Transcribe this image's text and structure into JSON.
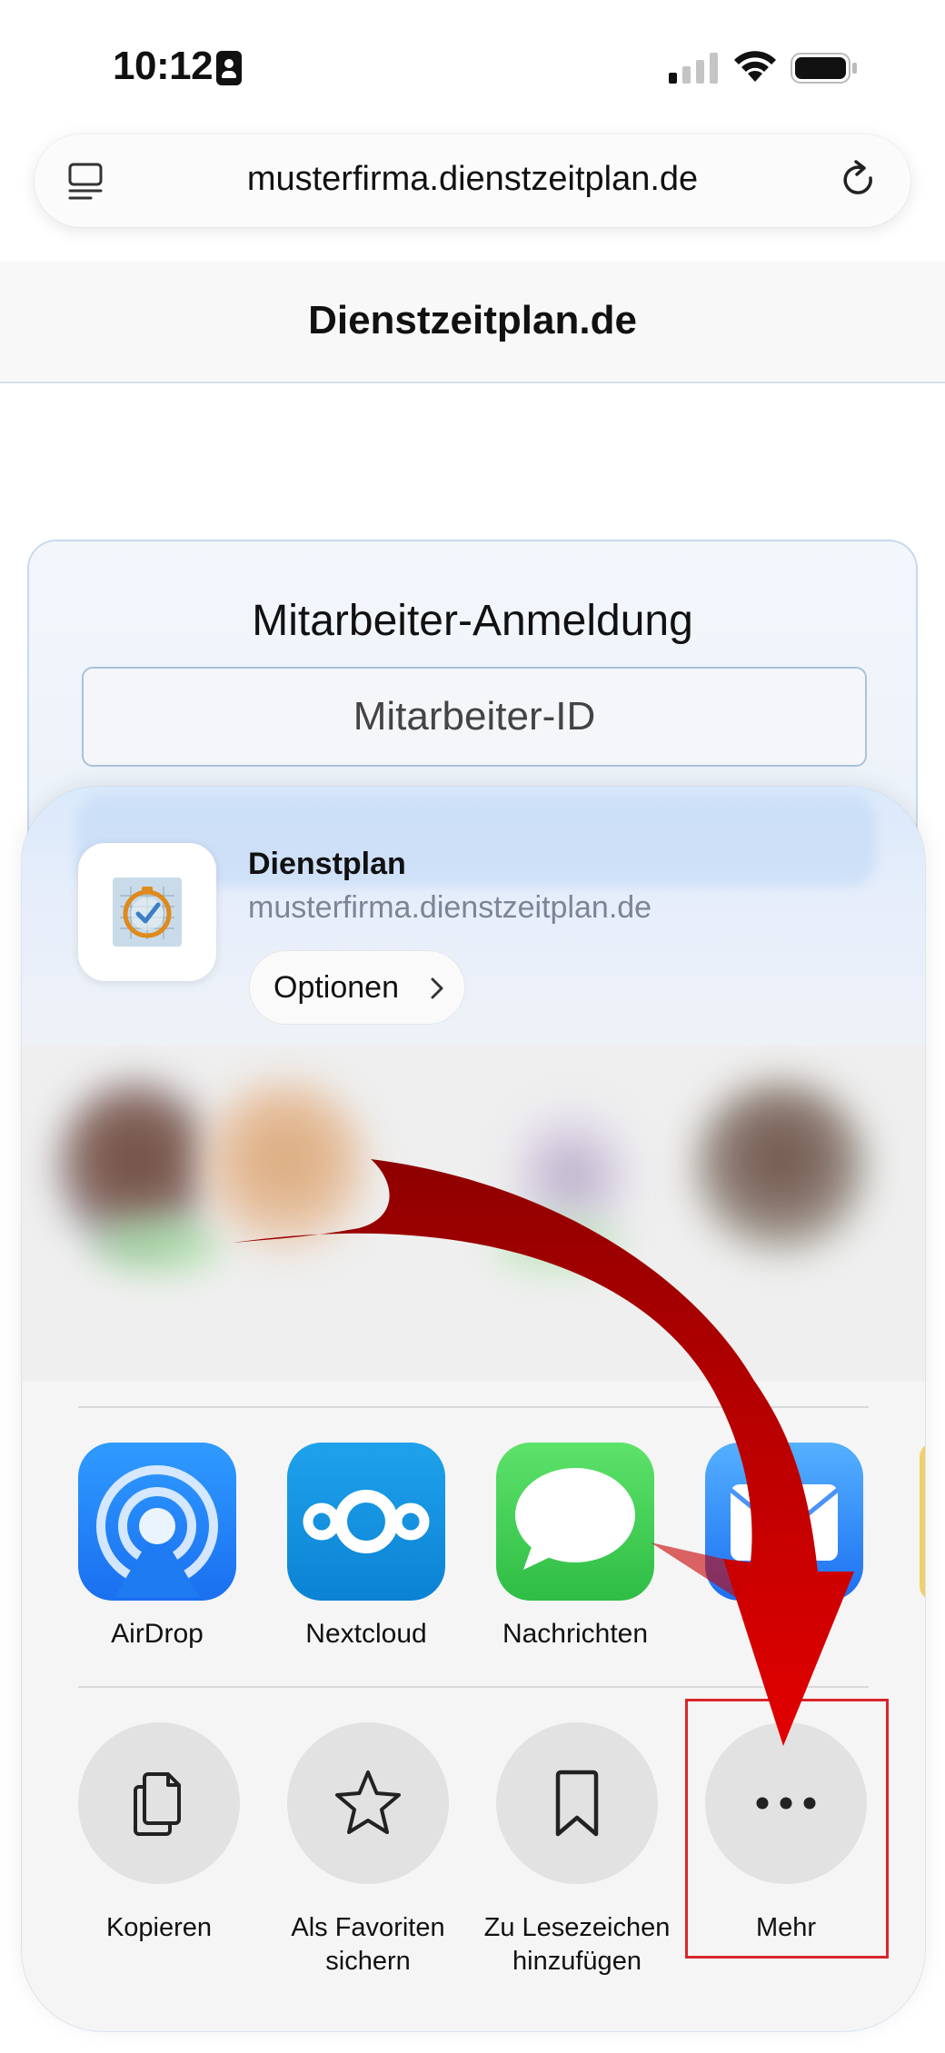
{
  "status_bar": {
    "time": "10:12"
  },
  "browser": {
    "url": "musterfirma.dienstzeitplan.de"
  },
  "page": {
    "site_title": "Dienstzeitplan.de",
    "login_title": "Mitarbeiter-Anmeldung",
    "employee_id_placeholder": "Mitarbeiter-ID"
  },
  "share_sheet": {
    "app_name": "Dienstplan",
    "app_url": "musterfirma.dienstzeitplan.de",
    "options_label": "Optionen",
    "apps": [
      {
        "label": "AirDrop",
        "icon": "airdrop-icon"
      },
      {
        "label": "Nextcloud",
        "icon": "nextcloud-icon"
      },
      {
        "label": "Nachrichten",
        "icon": "messages-icon"
      },
      {
        "label": "il",
        "icon": "mail-icon"
      }
    ],
    "actions": [
      {
        "label": "Kopieren",
        "icon": "copy-icon"
      },
      {
        "label": "Als Favoriten sichern",
        "icon": "star-icon"
      },
      {
        "label": "Zu Lesezeichen hinzufügen",
        "icon": "bookmark-icon"
      },
      {
        "label": "Mehr",
        "icon": "more-icon"
      }
    ]
  },
  "annotation": {
    "arrow_color": "#d40000",
    "highlight_color": "#d9252a"
  }
}
